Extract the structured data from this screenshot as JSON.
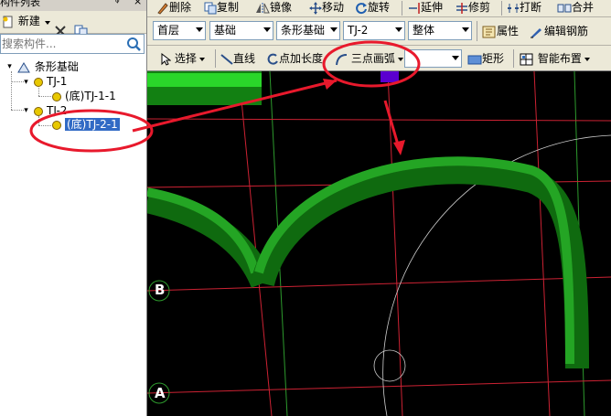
{
  "left_panel": {
    "title": "构件列表",
    "pin": "ᵠ",
    "close": "×",
    "toolbar": {
      "new_label": "新建"
    },
    "search": {
      "placeholder": "搜索构件..."
    },
    "tree": {
      "root": "条形基础",
      "groups": [
        {
          "name": "TJ-1",
          "child": "(底)TJ-1-1"
        },
        {
          "name": "TJ-2",
          "child": "(底)TJ-2-1"
        }
      ]
    }
  },
  "toolbar1": {
    "delete": "删除",
    "copy": "复制",
    "mirror": "镜像",
    "move": "移动",
    "rotate": "旋转",
    "extend": "延伸",
    "trim": "修剪",
    "break": "打断",
    "merge": "合并"
  },
  "toolbar2": {
    "floor": "首层",
    "category": "基础",
    "type": "条形基础",
    "component": "TJ-2",
    "sub": "整体",
    "properties": "属性",
    "edit_rebar": "编辑钢筋"
  },
  "toolbar3": {
    "select": "选择",
    "line": "直线",
    "point_length": "点加长度",
    "three_point_arc": "三点画弧",
    "rect": "矩形",
    "smart_place": "智能布置"
  },
  "canvas": {
    "axis_b": "B",
    "axis_a": "A"
  },
  "colors": {
    "highlight_red": "#e8192c",
    "beam_green": "#1a8f1a",
    "selection_blue": "#316ac5",
    "grid_red": "#cc2233"
  }
}
